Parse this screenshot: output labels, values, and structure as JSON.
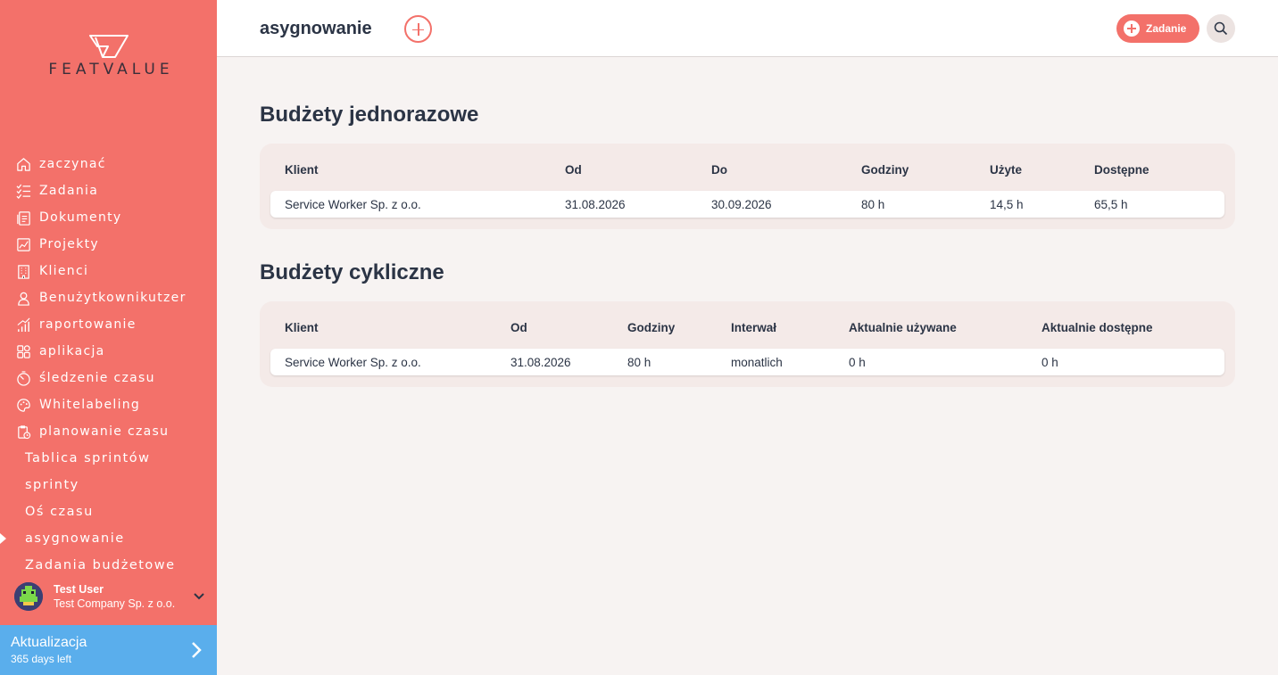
{
  "app": {
    "logo_text": "FEATVALUE",
    "page_title": "asygnowanie"
  },
  "sidebar": {
    "items": [
      {
        "label": "zaczynać",
        "icon": "home-icon"
      },
      {
        "label": "Zadania",
        "icon": "tasks-icon"
      },
      {
        "label": "Dokumenty",
        "icon": "documents-icon"
      },
      {
        "label": "Projekty",
        "icon": "projects-icon"
      },
      {
        "label": "Klienci",
        "icon": "building-icon"
      },
      {
        "label": "Benużytkownikutzer",
        "icon": "user-icon"
      },
      {
        "label": "raportowanie",
        "icon": "reports-icon"
      },
      {
        "label": "aplikacja",
        "icon": "apps-icon"
      },
      {
        "label": "śledzenie czasu",
        "icon": "timer-icon"
      },
      {
        "label": "Whitelabeling",
        "icon": "palette-icon"
      },
      {
        "label": "planowanie czasu",
        "icon": "planning-icon"
      }
    ],
    "subitems": [
      {
        "label": "Tablica sprintów"
      },
      {
        "label": "sprinty"
      },
      {
        "label": "Oś czasu"
      },
      {
        "label": "asygnowanie",
        "active": true
      },
      {
        "label": "Zadania budżetowe"
      }
    ]
  },
  "user": {
    "name": "Test User",
    "company": "Test Company Sp. z o.o."
  },
  "upgrade": {
    "title": "Aktualizacja",
    "subtitle": "365 days left"
  },
  "header": {
    "task_button_label": "Zadanie"
  },
  "one_time_budgets": {
    "title": "Budżety jednorazowe",
    "columns": [
      "Klient",
      "Od",
      "Do",
      "Godziny",
      "Użyte",
      "Dostępne"
    ],
    "rows": [
      [
        "Service Worker Sp. z o.o.",
        "31.08.2026",
        "30.09.2026",
        "80 h",
        "14,5 h",
        "65,5 h"
      ]
    ]
  },
  "cyclic_budgets": {
    "title": "Budżety cykliczne",
    "columns": [
      "Klient",
      "Od",
      "Godziny",
      "Interwał",
      "Aktualnie używane",
      "Aktualnie dostępne"
    ],
    "rows": [
      [
        "Service Worker Sp. z o.o.",
        "31.08.2026",
        "80 h",
        "monatlich",
        "0 h",
        "0 h"
      ]
    ]
  },
  "colors": {
    "sidebar": "#f3716a",
    "accent": "#f3716a",
    "upgrade": "#5aaeec",
    "text_dark": "#2b3445",
    "background": "#f7f3f2"
  }
}
